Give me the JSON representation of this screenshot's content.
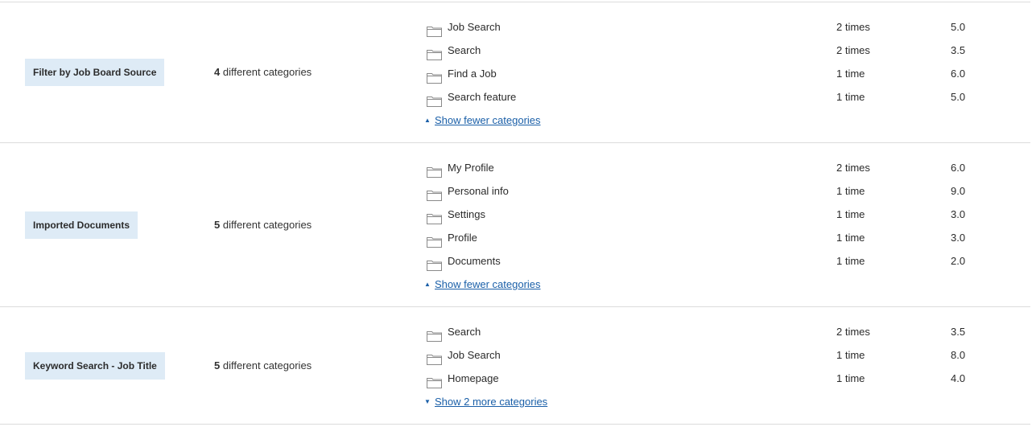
{
  "groups": [
    {
      "tag": "Filter by Job Board Source",
      "summary_count": "4",
      "summary_text": " different categories",
      "categories": [
        {
          "name": "Job Search",
          "count": "2 times",
          "score": "5.0"
        },
        {
          "name": "Search",
          "count": "2 times",
          "score": "3.5"
        },
        {
          "name": "Find a Job",
          "count": "1 time",
          "score": "6.0"
        },
        {
          "name": "Search feature",
          "count": "1 time",
          "score": "5.0"
        }
      ],
      "toggle_label": "Show fewer categories",
      "toggle_direction": "up"
    },
    {
      "tag": "Imported Documents",
      "summary_count": "5",
      "summary_text": " different categories",
      "categories": [
        {
          "name": "My Profile",
          "count": "2 times",
          "score": "6.0"
        },
        {
          "name": "Personal info",
          "count": "1 time",
          "score": "9.0"
        },
        {
          "name": "Settings",
          "count": "1 time",
          "score": "3.0"
        },
        {
          "name": "Profile",
          "count": "1 time",
          "score": "3.0"
        },
        {
          "name": "Documents",
          "count": "1 time",
          "score": "2.0"
        }
      ],
      "toggle_label": "Show fewer categories",
      "toggle_direction": "up"
    },
    {
      "tag": "Keyword Search - Job Title",
      "summary_count": "5",
      "summary_text": " different categories",
      "categories": [
        {
          "name": "Search",
          "count": "2 times",
          "score": "3.5"
        },
        {
          "name": "Job Search",
          "count": "1 time",
          "score": "8.0"
        },
        {
          "name": "Homepage",
          "count": "1 time",
          "score": "4.0"
        }
      ],
      "toggle_label": "Show 2 more categories",
      "toggle_direction": "down"
    }
  ],
  "icons": {
    "folder": "folder-icon",
    "toggle_up": "caret-up-icon",
    "toggle_down": "caret-down-icon"
  },
  "colors": {
    "tag_bg": "#deebf6",
    "link": "#1a5fa8",
    "divider": "#dcdcdc"
  }
}
